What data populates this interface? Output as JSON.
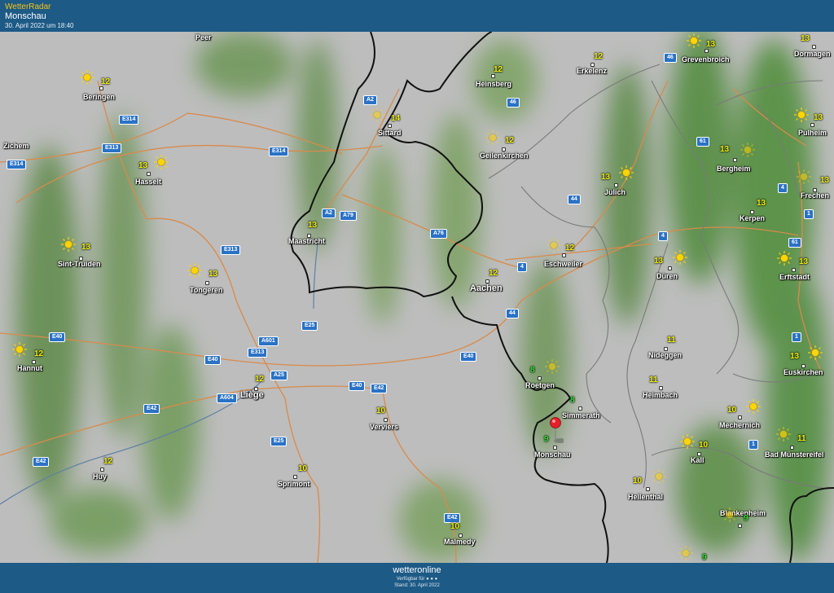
{
  "header": {
    "app_title": "WetterRadar",
    "location": "Monschau",
    "datetime": "30. April 2022 um 18:40"
  },
  "footer": {
    "brand": "wetteronline",
    "available": "Verfügbar für",
    "stand": "Stand: 30. April 2022"
  },
  "cities": [
    {
      "name": "Peer"
    },
    {
      "name": "Beringen"
    },
    {
      "name": "Zichem"
    },
    {
      "name": "Hasselt"
    },
    {
      "name": "Sint-Truiden"
    },
    {
      "name": "Tongeren"
    },
    {
      "name": "Hannut"
    },
    {
      "name": "Huy"
    },
    {
      "name": "Liège"
    },
    {
      "name": "Maastricht"
    },
    {
      "name": "Sittard"
    },
    {
      "name": "Heinsberg"
    },
    {
      "name": "Erkelenz"
    },
    {
      "name": "Geilenkirchen"
    },
    {
      "name": "Aachen"
    },
    {
      "name": "Eschweiler"
    },
    {
      "name": "Jülich"
    },
    {
      "name": "Düren"
    },
    {
      "name": "Grevenbroich"
    },
    {
      "name": "Dormagen"
    },
    {
      "name": "Pulheim"
    },
    {
      "name": "Bergheim"
    },
    {
      "name": "Frechen"
    },
    {
      "name": "Kerpen"
    },
    {
      "name": "Erftstadt"
    },
    {
      "name": "Nideggen"
    },
    {
      "name": "Heimbach"
    },
    {
      "name": "Euskirchen"
    },
    {
      "name": "Roetgen"
    },
    {
      "name": "Simmerath"
    },
    {
      "name": "Monschau"
    },
    {
      "name": "Verviers"
    },
    {
      "name": "Sprimont"
    },
    {
      "name": "Malmedy"
    },
    {
      "name": "Hellenthal"
    },
    {
      "name": "Mechernich"
    },
    {
      "name": "Kall"
    },
    {
      "name": "Bad Münstereifel"
    },
    {
      "name": "Blankenheim"
    }
  ],
  "temps": {
    "beringen": "12",
    "hasselt": "13",
    "sinttruiden": "13",
    "tongeren": "13",
    "hannut": "12",
    "huy": "12",
    "liege": "12",
    "maastricht": "13",
    "sittard": "14",
    "heinsberg": "12",
    "erkelenz": "12",
    "geilenkirchen": "12",
    "aachen": "12",
    "eschweiler": "12",
    "julich": "13",
    "duren": "13",
    "grevenbroich": "13",
    "dormagen": "13",
    "pulheim": "13",
    "bergheim": "13",
    "frechen": "13",
    "kerpen": "13",
    "erftstadt": "13",
    "nideggen": "11",
    "heimbach": "11",
    "euskirchen": "13",
    "roetgen": "8",
    "simmerath": "8",
    "monschau": "9",
    "verviers": "10",
    "sprimont": "10",
    "malmedy": "10",
    "hellenthal": "10",
    "mechernich": "10",
    "kall": "10",
    "badmuenstereifel": "11",
    "blankenheim": "9",
    "bottom": "9"
  },
  "roads": [
    "E314",
    "E313",
    "E314",
    "E314",
    "A2",
    "46",
    "46",
    "61",
    "44",
    "4",
    "4",
    "1",
    "61",
    "1",
    "A2",
    "A79",
    "A76",
    "4",
    "E313",
    "44",
    "E25",
    "A601",
    "E313",
    "E40",
    "E40",
    "A25",
    "E40",
    "E40",
    "E42",
    "A604",
    "E42",
    "E42",
    "E25",
    "E42",
    "1",
    "E40"
  ],
  "colors": {
    "header_bg": "#1d5a86",
    "app_title": "#f5c518",
    "temp": "#f0f000",
    "temp_low": "#33dd33",
    "border": "#111111",
    "road_line": "#d98a4a"
  }
}
